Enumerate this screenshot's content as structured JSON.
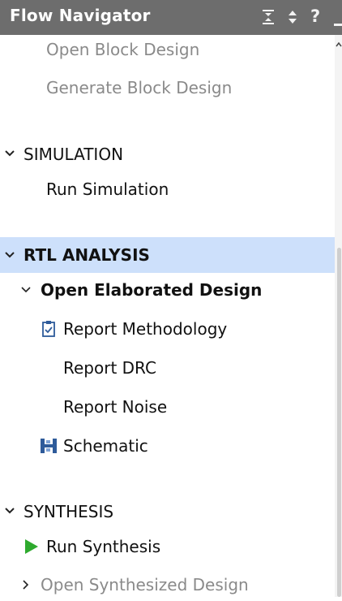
{
  "header": {
    "title": "Flow Navigator",
    "icons": [
      "collapse-all-icon",
      "expand-sort-icon",
      "help-icon",
      "minimize-icon"
    ],
    "help_glyph": "?"
  },
  "colors": {
    "header_bg": "#6d6d6d",
    "selected_bg": "#cde0fb",
    "muted_text": "#8a8a8a",
    "run_green": "#2eaa2e"
  },
  "items": {
    "open_block_design": "Open Block Design",
    "generate_block_design": "Generate Block Design",
    "simulation_header": "SIMULATION",
    "run_simulation": "Run Simulation",
    "rtl_header": "RTL ANALYSIS",
    "open_elaborated": "Open Elaborated Design",
    "report_methodology": "Report Methodology",
    "report_drc": "Report DRC",
    "report_noise": "Report Noise",
    "schematic": "Schematic",
    "synthesis_header": "SYNTHESIS",
    "run_synthesis": "Run Synthesis",
    "open_synthesized": "Open Synthesized Design"
  }
}
